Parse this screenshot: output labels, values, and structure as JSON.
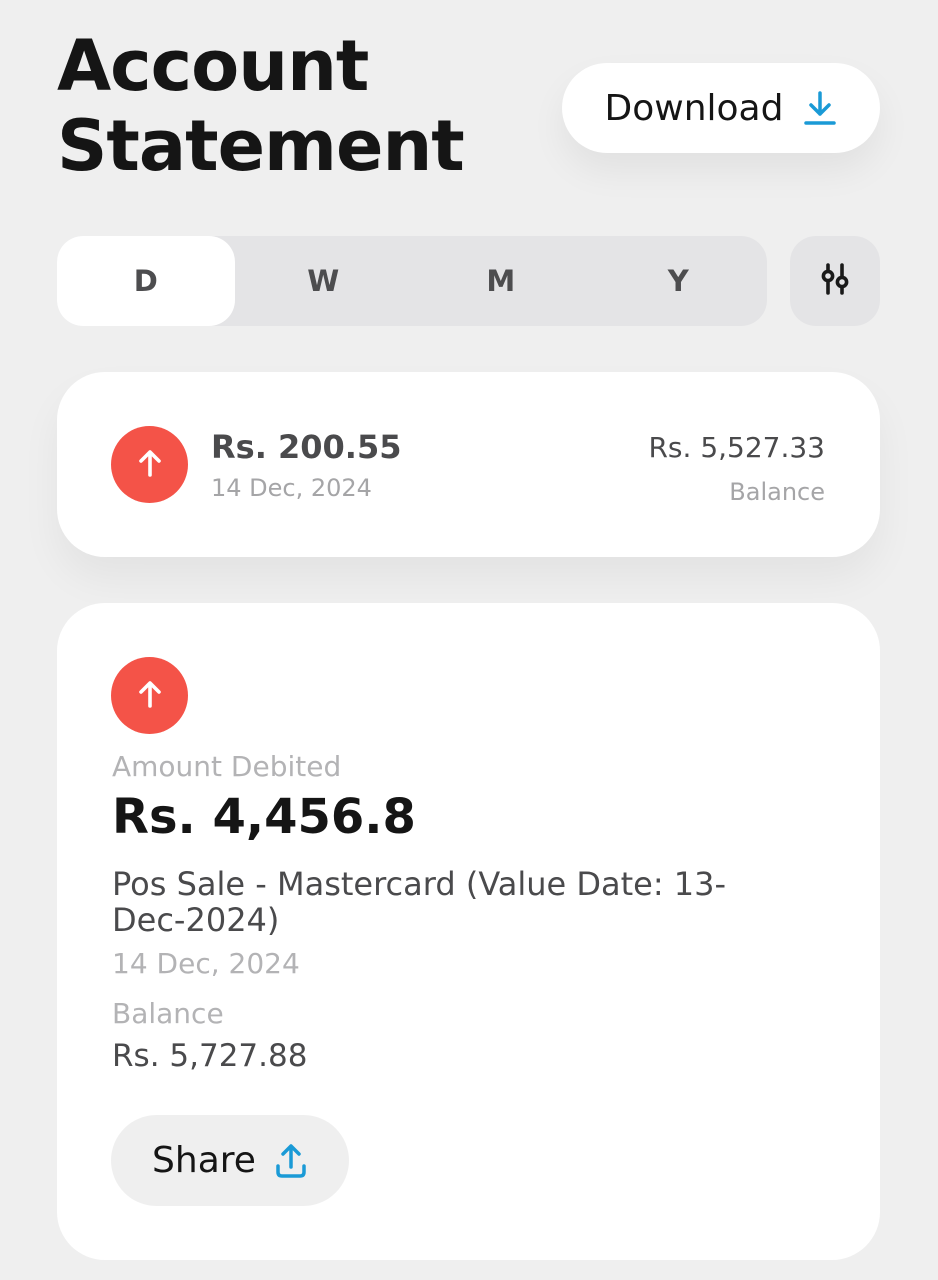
{
  "header": {
    "title_line1": "Account",
    "title_line2": "Statement",
    "download_label": "Download"
  },
  "period_tabs": [
    {
      "label": "D",
      "selected": true
    },
    {
      "label": "W",
      "selected": false
    },
    {
      "label": "M",
      "selected": false
    },
    {
      "label": "Y",
      "selected": false
    }
  ],
  "icons": {
    "download": "download-icon",
    "filter": "sliders-icon",
    "debit": "arrow-up-icon",
    "share": "share-upload-icon"
  },
  "colors": {
    "accent": "#1a9ad6",
    "debit": "#f45348",
    "background": "#efefef"
  },
  "summary": {
    "amount": "Rs. 200.55",
    "date": "14 Dec, 2024",
    "balance_value": "Rs. 5,527.33",
    "balance_label": "Balance"
  },
  "detail": {
    "type_label": "Amount Debited",
    "amount": "Rs. 4,456.8",
    "description": "Pos Sale - Mastercard   (Value Date: 13-Dec-2024)",
    "date": "14 Dec, 2024",
    "balance_label": "Balance",
    "balance_value": "Rs. 5,727.88",
    "share_label": "Share"
  }
}
